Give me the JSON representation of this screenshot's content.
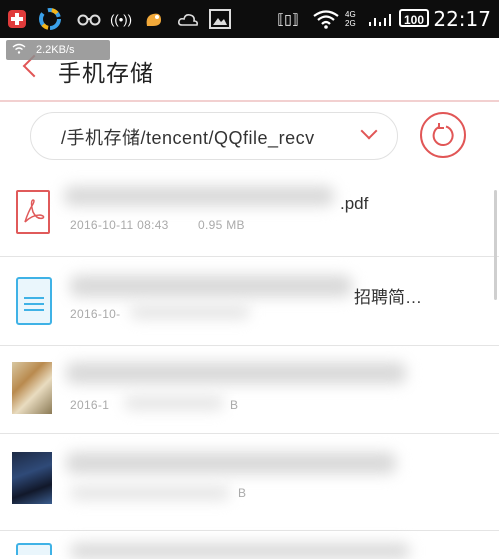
{
  "status_bar": {
    "time": "22:17",
    "battery": "100",
    "network": "4G 2G",
    "icons": [
      "notification-icon",
      "app-icon",
      "glasses-icon",
      "radio-icon",
      "squirrel-icon",
      "weather-icon",
      "image-icon",
      "vibrate-icon",
      "wifi-icon",
      "signal-icon"
    ]
  },
  "speed_overlay": {
    "text": "2.2KB/s"
  },
  "header": {
    "title": "手机存储"
  },
  "path_bar": {
    "path": "/手机存储/tencent/QQfile_recv"
  },
  "files": [
    {
      "name_suffix": ".pdf",
      "date": "2016-10-11 08:43",
      "size": "0.95 MB",
      "type": "pdf"
    },
    {
      "name_suffix": "招聘简…",
      "date_prefix": "2016-10-",
      "type": "doc"
    },
    {
      "date_prefix": "2016-1",
      "size_suffix": "B",
      "type": "image"
    },
    {
      "size_suffix": "B",
      "type": "image-dark"
    }
  ],
  "colors": {
    "accent": "#e15656",
    "doc_blue": "#3fb2e6",
    "status_bg": "#0d0d0d"
  }
}
